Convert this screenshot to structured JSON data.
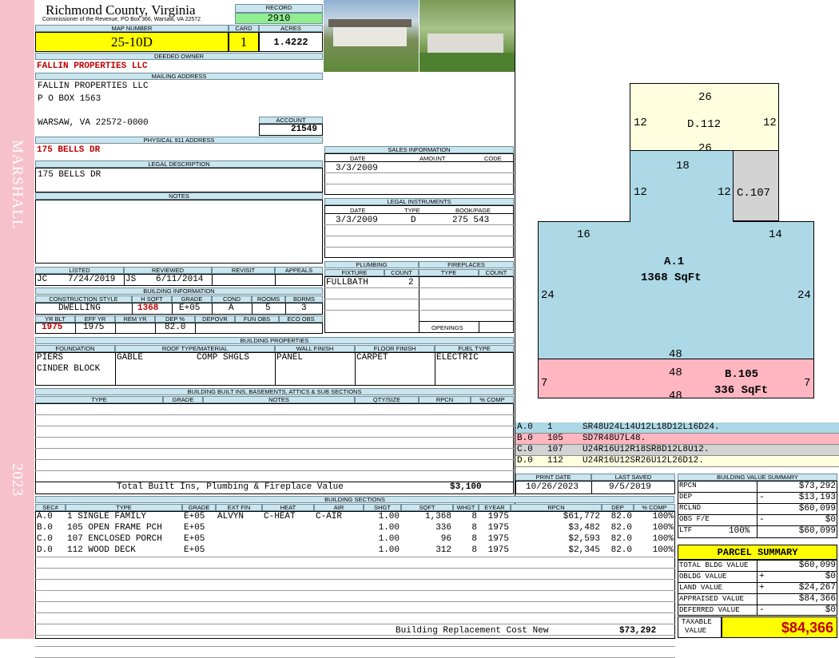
{
  "sidebar": {
    "district": "MARSHALL",
    "year": "2023"
  },
  "header": {
    "county": "Richmond County, Virginia",
    "office": "Commissioner of the Revenue, PO Box 366, Warsaw, VA 22572",
    "record_label": "RECORD",
    "record": "2910",
    "map_label": "MAP NUMBER",
    "map_number": "25-10D",
    "card_label": "CARD",
    "card": "1",
    "acres_label": "ACRES",
    "acres": "1.4222"
  },
  "owner": {
    "deeded_label": "DEEDED OWNER",
    "deeded": "FALLIN PROPERTIES LLC",
    "mailing_label": "MAILING ADDRESS",
    "line1": "FALLIN PROPERTIES LLC",
    "line2": "P O BOX 1563",
    "line3": "WARSAW, VA 22572-0000",
    "account_label": "ACCOUNT",
    "account": "21549",
    "phys_label": "PHYSICAL 911 ADDRESS",
    "physical": "175 BELLS DR",
    "legal_label": "LEGAL DESCRIPTION",
    "legal": "175 BELLS DR",
    "notes_label": "NOTES"
  },
  "sales": {
    "title": "SALES INFORMATION",
    "h": [
      "DATE",
      "AMOUNT",
      "CODE"
    ],
    "date": "3/3/2009"
  },
  "legal_inst": {
    "title": "LEGAL INSTRUMENTS",
    "h": [
      "DATE",
      "TYPE",
      "BOOK/PAGE"
    ],
    "date": "3/3/2009",
    "type": "D",
    "book": "275 543"
  },
  "listed": {
    "h": [
      "LISTED",
      "REVIEWED",
      "REVISIT",
      "APPEALS"
    ],
    "list_by": "JC",
    "list_date": "7/24/2019",
    "rev_by": "JS",
    "rev_date": "6/11/2014"
  },
  "plumbing": {
    "title": "PLUMBING",
    "h": [
      "FIXTURE",
      "COUNT"
    ],
    "fixture": "FULLBATH",
    "count": "2"
  },
  "fireplaces": {
    "title": "FIREPLACES",
    "h": [
      "TYPE",
      "COUNT"
    ],
    "openings": "OPENINGS"
  },
  "bldg_info": {
    "title": "BUILDING INFORMATION",
    "h": [
      "CONSTRUCTION STYLE",
      "H SQFT",
      "GRADE",
      "COND",
      "ROOMS",
      "BDRMS"
    ],
    "style": "DWELLING",
    "sqft": "1368",
    "grade": "E+05",
    "cond": "A",
    "rooms": "5",
    "bdrms": "3",
    "h2": [
      "YR BLT",
      "EFF YR",
      "REM YR",
      "DEP %",
      "DEPOVR",
      "FUN OBS",
      "ECO OBS"
    ],
    "yrblt": "1975",
    "effyr": "1975",
    "dep": "82.0"
  },
  "bldg_props": {
    "title": "BUILDING PROPERTIES",
    "h": [
      "FOUNDATION",
      "ROOF TYPE/MATERIAL",
      "WALL FINISH",
      "FLOOR FINISH",
      "FUEL TYPE"
    ],
    "found1": "PIERS",
    "found2": "CINDER BLOCK",
    "roof1": "GABLE",
    "roof2": "COMP SHGLS",
    "wall": "PANEL",
    "floor": "CARPET",
    "fuel": "ELECTRIC"
  },
  "builtins": {
    "title": "BUILDING BUILT INS, BASEMENTS, ATTICS & SUB SECTIONS",
    "h": [
      "TYPE",
      "GRADE",
      "NOTES",
      "QTY/SIZE",
      "RPCN",
      "% COMP"
    ],
    "total_label": "Total Built Ins, Plumbing & Fireplace Value",
    "total": "$3,100"
  },
  "print": {
    "h": [
      "PRINT DATE",
      "LAST SAVED"
    ],
    "print": "10/26/2023",
    "saved": "9/5/2019"
  },
  "sections": {
    "title": "BUILDING SECTIONS",
    "h": [
      "SEC#",
      "TYPE",
      "GRADE",
      "EXT FIN",
      "HEAT",
      "AIR",
      "SHGT",
      "SQFT",
      "WHGT",
      "EYEAR",
      "RPCN",
      "DEP",
      "% COMP"
    ],
    "rows": [
      {
        "sec": "A.0",
        "type": "1 SINGLE FAMILY",
        "grade": "E+05",
        "ext": "ALVYN",
        "heat": "C-HEAT",
        "air": "C-AIR",
        "shgt": "1.00",
        "sqft": "1,368",
        "whgt": "8",
        "eyear": "1975",
        "rpcn": "$61,772",
        "dep": "82.0",
        "comp": "100%"
      },
      {
        "sec": "B.0",
        "type": "105 OPEN FRAME PCH",
        "grade": "E+05",
        "ext": "",
        "heat": "",
        "air": "",
        "shgt": "1.00",
        "sqft": "336",
        "whgt": "8",
        "eyear": "1975",
        "rpcn": "$3,482",
        "dep": "82.0",
        "comp": "100%"
      },
      {
        "sec": "C.0",
        "type": "107 ENCLOSED PORCH",
        "grade": "E+05",
        "ext": "",
        "heat": "",
        "air": "",
        "shgt": "1.00",
        "sqft": "96",
        "whgt": "8",
        "eyear": "1975",
        "rpcn": "$2,593",
        "dep": "82.0",
        "comp": "100%"
      },
      {
        "sec": "D.0",
        "type": "112 WOOD DECK",
        "grade": "E+05",
        "ext": "",
        "heat": "",
        "air": "",
        "shgt": "1.00",
        "sqft": "312",
        "whgt": "8",
        "eyear": "1975",
        "rpcn": "$2,345",
        "dep": "82.0",
        "comp": "100%"
      }
    ],
    "replace_label": "Building Replacement Cost New",
    "replace": "$73,292"
  },
  "sketch": {
    "d_label": "D.112",
    "c_label": "C.107",
    "a_label": "A.1",
    "a_sqft": "1368 SqFt",
    "b_label": "B.105",
    "b_sqft": "336 SqFt",
    "dims": [
      "26",
      "12",
      "12",
      "26",
      "18",
      "12",
      "12",
      "16",
      "14",
      "24",
      "24",
      "48",
      "48",
      "7",
      "7",
      "48"
    ]
  },
  "legend": [
    {
      "sec": "A.0",
      "num": "1",
      "path": "SR48U24L14U12L18D12L16D24.",
      "color": "#add8e6"
    },
    {
      "sec": "B.0",
      "num": "105",
      "path": "SD7R48U7L48.",
      "color": "#ffb6c1"
    },
    {
      "sec": "C.0",
      "num": "107",
      "path": "U24R16U12R18SR8D12L8U12.",
      "color": "#d3d3d3"
    },
    {
      "sec": "D.0",
      "num": "112",
      "path": "U24R16U12SR26U12L26D12.",
      "color": "#ffffe0"
    }
  ],
  "bv": {
    "title": "BUILDING VALUE SUMMARY",
    "rpcn_l": "RPCN",
    "rpcn": "$73,292",
    "dep_l": "DEP",
    "dep_s": "-",
    "dep": "$13,193",
    "rclnd_l": "RCLND",
    "rclnd": "$60,099",
    "obs_l": "OBS F/E",
    "obs_s": "-",
    "obs": "$0",
    "ltf_l": "LTF",
    "ltf_p": "100%",
    "ltf": "$60,099"
  },
  "ps": {
    "title": "PARCEL SUMMARY",
    "tbv_l": "TOTAL BLDG VALUE",
    "tbv": "$60,099",
    "ob_l": "OBLDG VALUE",
    "ob_s": "+",
    "ob": "$0",
    "land_l": "LAND VALUE",
    "land_s": "+",
    "land": "$24,267",
    "app_l": "APPRAISED VALUE",
    "app": "$84,366",
    "def_l": "DEFERRED VALUE",
    "def_s": "-",
    "def": "$0",
    "tax_l1": "TAXABLE",
    "tax_l2": "VALUE",
    "tax": "$84,366"
  }
}
